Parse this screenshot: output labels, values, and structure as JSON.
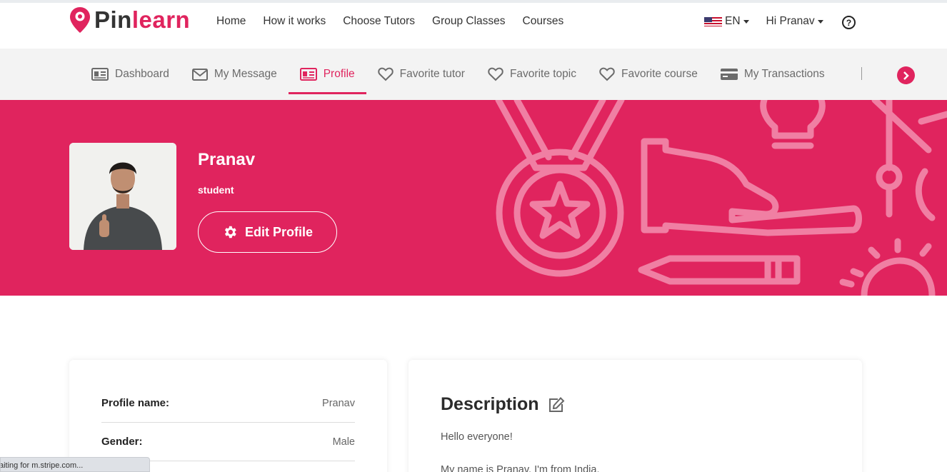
{
  "brand": {
    "name_part1": "Pin",
    "name_part2": "learn",
    "accent": "#e0245e"
  },
  "main_nav": [
    "Home",
    "How it works",
    "Choose Tutors",
    "Group Classes",
    "Courses"
  ],
  "language": "EN",
  "greeting": "Hi Pranav",
  "help_label": "?",
  "sub_nav": [
    {
      "label": "Dashboard",
      "icon": "id-card-icon"
    },
    {
      "label": "My Message",
      "icon": "envelope-icon"
    },
    {
      "label": "Profile",
      "icon": "id-card-icon",
      "active": true
    },
    {
      "label": "Favorite tutor",
      "icon": "heart-icon"
    },
    {
      "label": "Favorite topic",
      "icon": "heart-icon"
    },
    {
      "label": "Favorite course",
      "icon": "heart-icon"
    },
    {
      "label": "My Transactions",
      "icon": "credit-card-icon"
    }
  ],
  "profile": {
    "name": "Pranav",
    "role": "student",
    "edit_label": "Edit Profile"
  },
  "details": [
    {
      "label": "Profile name:",
      "value": "Pranav"
    },
    {
      "label": "Gender:",
      "value": "Male"
    }
  ],
  "description": {
    "title": "Description",
    "p1": "Hello everyone!",
    "p2": "My name is Pranav, I'm from India."
  },
  "status_bar": "Waiting for m.stripe.com..."
}
